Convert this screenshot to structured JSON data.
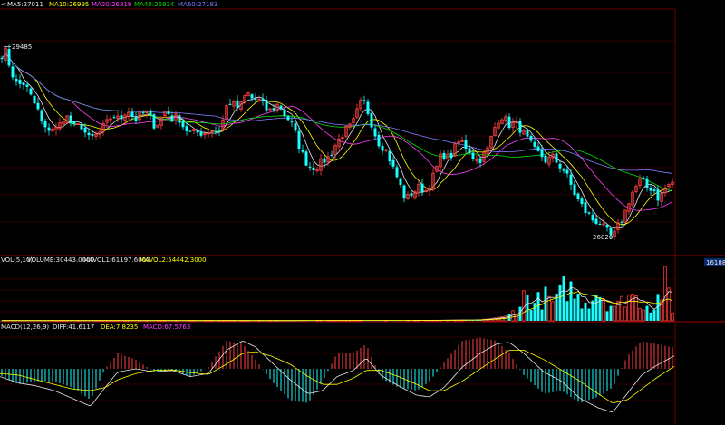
{
  "chart_data": [
    {
      "type": "candlestick",
      "panel": "price",
      "header_prefix": "<",
      "indicators": [
        {
          "label": "MA5:27011",
          "color": "#e6e6e6"
        },
        {
          "label": "MA10:26995",
          "color": "#ffff00"
        },
        {
          "label": "MA20:26819",
          "color": "#ff40ff"
        },
        {
          "label": "MA40:26834",
          "color": "#00e000"
        },
        {
          "label": "MA60:27183",
          "color": "#7b7bff"
        }
      ],
      "annotations": {
        "high": "29485",
        "low": "26020"
      },
      "ylim": [
        25800,
        30100
      ],
      "colors": {
        "up": "#ff4040",
        "down": "#19ffff",
        "grid": "#5a0000",
        "frame": "#a00000"
      },
      "close_path": [
        [
          0,
          29200
        ],
        [
          4,
          29485
        ],
        [
          8,
          29300
        ],
        [
          12,
          29050
        ],
        [
          16,
          28900
        ],
        [
          20,
          28750
        ],
        [
          24,
          28850
        ],
        [
          28,
          28780
        ],
        [
          32,
          28650
        ],
        [
          36,
          28500
        ],
        [
          40,
          28400
        ],
        [
          44,
          28250
        ],
        [
          48,
          28000
        ],
        [
          52,
          27950
        ],
        [
          56,
          28050
        ],
        [
          60,
          27980
        ],
        [
          64,
          28000
        ],
        [
          68,
          28150
        ],
        [
          72,
          28250
        ],
        [
          76,
          28150
        ],
        [
          80,
          28050
        ],
        [
          84,
          27980
        ],
        [
          88,
          28100
        ],
        [
          92,
          28000
        ],
        [
          96,
          27850
        ],
        [
          100,
          27780
        ],
        [
          104,
          27900
        ],
        [
          108,
          27850
        ],
        [
          112,
          28000
        ],
        [
          116,
          28050
        ],
        [
          120,
          28150
        ],
        [
          124,
          28250
        ],
        [
          128,
          28200
        ],
        [
          132,
          28150
        ],
        [
          136,
          28250
        ],
        [
          140,
          28350
        ],
        [
          144,
          28300
        ],
        [
          148,
          28150
        ],
        [
          152,
          28200
        ],
        [
          156,
          28250
        ],
        [
          160,
          28300
        ],
        [
          164,
          28250
        ],
        [
          168,
          28100
        ],
        [
          172,
          28050
        ],
        [
          176,
          28150
        ],
        [
          180,
          28250
        ],
        [
          184,
          28350
        ],
        [
          188,
          28200
        ],
        [
          192,
          28150
        ],
        [
          196,
          28250
        ],
        [
          200,
          28100
        ],
        [
          204,
          28000
        ],
        [
          208,
          27950
        ],
        [
          212,
          27900
        ],
        [
          216,
          27950
        ],
        [
          220,
          27900
        ],
        [
          224,
          27950
        ],
        [
          228,
          27900
        ],
        [
          232,
          28000
        ],
        [
          236,
          27950
        ],
        [
          240,
          27950
        ],
        [
          244,
          28000
        ],
        [
          248,
          28300
        ],
        [
          252,
          28500
        ],
        [
          256,
          28450
        ],
        [
          260,
          28400
        ],
        [
          264,
          28350
        ],
        [
          268,
          28500
        ],
        [
          272,
          28650
        ],
        [
          276,
          28600
        ],
        [
          280,
          28500
        ],
        [
          284,
          28550
        ],
        [
          288,
          28450
        ],
        [
          292,
          28400
        ],
        [
          296,
          28300
        ],
        [
          300,
          28350
        ],
        [
          304,
          28400
        ],
        [
          308,
          28450
        ],
        [
          312,
          28300
        ],
        [
          316,
          28200
        ],
        [
          320,
          28150
        ],
        [
          324,
          28000
        ],
        [
          328,
          27800
        ],
        [
          332,
          27600
        ],
        [
          336,
          27450
        ],
        [
          340,
          27350
        ],
        [
          344,
          27300
        ],
        [
          348,
          27300
        ],
        [
          352,
          27350
        ],
        [
          356,
          27400
        ],
        [
          360,
          27450
        ],
        [
          364,
          27500
        ],
        [
          368,
          27650
        ],
        [
          372,
          27750
        ],
        [
          376,
          27850
        ],
        [
          380,
          27950
        ],
        [
          384,
          28000
        ],
        [
          388,
          28050
        ],
        [
          392,
          28200
        ],
        [
          396,
          28400
        ],
        [
          400,
          28500
        ],
        [
          404,
          28400
        ],
        [
          408,
          28200
        ],
        [
          412,
          28000
        ],
        [
          416,
          27800
        ],
        [
          420,
          27700
        ],
        [
          424,
          27650
        ],
        [
          428,
          27550
        ],
        [
          432,
          27350
        ],
        [
          436,
          27200
        ],
        [
          440,
          27050
        ],
        [
          444,
          26850
        ],
        [
          448,
          26700
        ],
        [
          452,
          26800
        ],
        [
          456,
          26850
        ],
        [
          460,
          26900
        ],
        [
          464,
          26950
        ],
        [
          468,
          26850
        ],
        [
          472,
          26900
        ],
        [
          476,
          27050
        ],
        [
          480,
          27200
        ],
        [
          484,
          27400
        ],
        [
          488,
          27550
        ],
        [
          492,
          27500
        ],
        [
          496,
          27450
        ],
        [
          500,
          27600
        ],
        [
          504,
          27700
        ],
        [
          508,
          27800
        ],
        [
          512,
          27700
        ],
        [
          516,
          27650
        ],
        [
          520,
          27550
        ],
        [
          524,
          27450
        ],
        [
          528,
          27400
        ],
        [
          532,
          27500
        ],
        [
          536,
          27550
        ],
        [
          540,
          27700
        ],
        [
          544,
          27950
        ],
        [
          548,
          28100
        ],
        [
          552,
          28250
        ],
        [
          556,
          28200
        ],
        [
          560,
          28100
        ],
        [
          564,
          28050
        ],
        [
          568,
          28100
        ],
        [
          572,
          28050
        ],
        [
          576,
          27950
        ],
        [
          580,
          27850
        ],
        [
          584,
          27750
        ],
        [
          588,
          27650
        ],
        [
          592,
          27550
        ],
        [
          596,
          27550
        ],
        [
          600,
          27450
        ],
        [
          604,
          27400
        ],
        [
          608,
          27500
        ],
        [
          612,
          27450
        ],
        [
          616,
          27350
        ],
        [
          620,
          27300
        ],
        [
          624,
          27200
        ],
        [
          628,
          27050
        ],
        [
          632,
          26900
        ],
        [
          636,
          26750
        ],
        [
          640,
          26650
        ],
        [
          644,
          26550
        ],
        [
          648,
          26450
        ],
        [
          652,
          26400
        ],
        [
          656,
          26300
        ],
        [
          660,
          26350
        ],
        [
          664,
          26250
        ],
        [
          668,
          26150
        ],
        [
          672,
          26100
        ],
        [
          676,
          26020
        ],
        [
          680,
          26150
        ],
        [
          684,
          26300
        ],
        [
          688,
          26400
        ],
        [
          692,
          26600
        ],
        [
          696,
          26800
        ],
        [
          700,
          26900
        ],
        [
          704,
          27000
        ],
        [
          708,
          27100
        ],
        [
          712,
          26950
        ],
        [
          716,
          26900
        ],
        [
          720,
          26950
        ],
        [
          724,
          26800
        ],
        [
          728,
          26700
        ],
        [
          732,
          26900
        ],
        [
          736,
          26950
        ],
        [
          740,
          27011
        ],
        [
          744,
          27050
        ]
      ]
    },
    {
      "type": "bar",
      "panel": "volume",
      "header": [
        {
          "label": "VOL(5,10)",
          "color": "#e6e6e6"
        },
        {
          "label": "VOLUME:30443.0000",
          "color": "#e6e6e6"
        },
        {
          "label": "MAVOL1:61197.6000",
          "color": "#e6e6e6"
        },
        {
          "label": "MAVOL2:54442.3000",
          "color": "#ffff00"
        }
      ],
      "axis_tag": "161884",
      "ylim": [
        0,
        161884
      ],
      "volume_path": [
        [
          0,
          900
        ],
        [
          300,
          900
        ],
        [
          450,
          1200
        ],
        [
          520,
          2500
        ],
        [
          540,
          6000
        ],
        [
          560,
          15000
        ],
        [
          572,
          60000
        ],
        [
          580,
          110000
        ],
        [
          590,
          70000
        ],
        [
          600,
          100000
        ],
        [
          612,
          70000
        ],
        [
          626,
          150000
        ],
        [
          636,
          95000
        ],
        [
          648,
          80000
        ],
        [
          660,
          130000
        ],
        [
          672,
          70000
        ],
        [
          684,
          60000
        ],
        [
          692,
          120000
        ],
        [
          702,
          90000
        ],
        [
          712,
          70000
        ],
        [
          722,
          60000
        ],
        [
          734,
          161884
        ],
        [
          742,
          30443
        ]
      ]
    },
    {
      "type": "bar",
      "panel": "macd",
      "header": [
        {
          "label": "MACD(12,26,9)",
          "color": "#e6e6e6"
        },
        {
          "label": "DIFF:41.6117",
          "color": "#e6e6e6"
        },
        {
          "label": "DEA:7.8235",
          "color": "#ffff00"
        },
        {
          "label": "MACD:67.5763",
          "color": "#ff40ff"
        }
      ],
      "ylim": [
        -160,
        160
      ],
      "diff_path": [
        [
          0,
          -25
        ],
        [
          20,
          -45
        ],
        [
          40,
          -55
        ],
        [
          60,
          -70
        ],
        [
          80,
          -95
        ],
        [
          100,
          -120
        ],
        [
          116,
          -60
        ],
        [
          130,
          -10
        ],
        [
          150,
          0
        ],
        [
          170,
          -10
        ],
        [
          190,
          -5
        ],
        [
          210,
          -25
        ],
        [
          230,
          -15
        ],
        [
          250,
          60
        ],
        [
          268,
          90
        ],
        [
          282,
          70
        ],
        [
          300,
          20
        ],
        [
          320,
          -35
        ],
        [
          340,
          -80
        ],
        [
          356,
          -70
        ],
        [
          372,
          -25
        ],
        [
          390,
          -5
        ],
        [
          404,
          35
        ],
        [
          420,
          -20
        ],
        [
          440,
          -55
        ],
        [
          460,
          -85
        ],
        [
          474,
          -90
        ],
        [
          490,
          -60
        ],
        [
          510,
          5
        ],
        [
          530,
          50
        ],
        [
          548,
          80
        ],
        [
          562,
          85
        ],
        [
          578,
          50
        ],
        [
          600,
          -10
        ],
        [
          620,
          -40
        ],
        [
          640,
          -95
        ],
        [
          660,
          -125
        ],
        [
          676,
          -140
        ],
        [
          692,
          -80
        ],
        [
          708,
          -20
        ],
        [
          724,
          10
        ],
        [
          744,
          42
        ]
      ],
      "dea_path": [
        [
          0,
          -15
        ],
        [
          20,
          -20
        ],
        [
          40,
          -35
        ],
        [
          60,
          -50
        ],
        [
          80,
          -65
        ],
        [
          100,
          -70
        ],
        [
          116,
          -60
        ],
        [
          130,
          -35
        ],
        [
          150,
          -15
        ],
        [
          170,
          -5
        ],
        [
          190,
          -3
        ],
        [
          210,
          -12
        ],
        [
          230,
          -18
        ],
        [
          250,
          15
        ],
        [
          268,
          50
        ],
        [
          282,
          55
        ],
        [
          300,
          40
        ],
        [
          320,
          15
        ],
        [
          340,
          -25
        ],
        [
          356,
          -50
        ],
        [
          372,
          -50
        ],
        [
          390,
          -30
        ],
        [
          404,
          -5
        ],
        [
          420,
          -5
        ],
        [
          440,
          -25
        ],
        [
          460,
          -50
        ],
        [
          474,
          -70
        ],
        [
          490,
          -70
        ],
        [
          510,
          -40
        ],
        [
          530,
          0
        ],
        [
          548,
          35
        ],
        [
          562,
          60
        ],
        [
          578,
          60
        ],
        [
          600,
          30
        ],
        [
          620,
          -5
        ],
        [
          640,
          -40
        ],
        [
          660,
          -80
        ],
        [
          676,
          -110
        ],
        [
          692,
          -100
        ],
        [
          708,
          -65
        ],
        [
          724,
          -30
        ],
        [
          744,
          8
        ]
      ]
    }
  ]
}
